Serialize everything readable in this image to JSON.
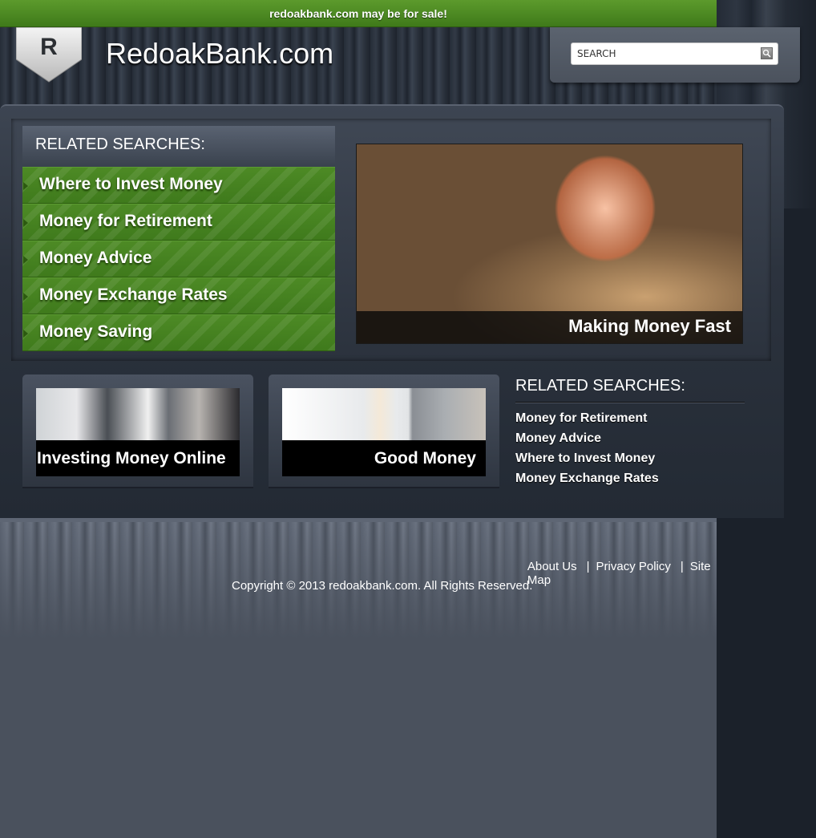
{
  "sale_banner": "redoakbank.com may be for sale!",
  "logo": {
    "letter": "R",
    "icon": "shield-badge-icon"
  },
  "site_title": "RedoakBank.com",
  "search": {
    "placeholder": "SEARCH",
    "icon": "search-icon"
  },
  "related_searches_main": {
    "heading": "RELATED SEARCHES:",
    "items": [
      {
        "label": "Where to Invest Money"
      },
      {
        "label": "Money for Retirement"
      },
      {
        "label": "Money Advice"
      },
      {
        "label": "Money Exchange Rates"
      },
      {
        "label": "Money Saving"
      }
    ]
  },
  "feature": {
    "caption": "Making Money Fast"
  },
  "cards": [
    {
      "title": "Investing Money Online"
    },
    {
      "title": "Good Money"
    }
  ],
  "related_searches_side": {
    "heading": "RELATED SEARCHES:",
    "items": [
      {
        "label": "Money for Retirement"
      },
      {
        "label": "Money Advice"
      },
      {
        "label": "Where to Invest Money"
      },
      {
        "label": "Money Exchange Rates"
      }
    ]
  },
  "footer": {
    "links": [
      {
        "label": "About Us"
      },
      {
        "label": "Privacy Policy"
      },
      {
        "label": "Site Map"
      }
    ],
    "separator": "|",
    "copyright": "Copyright © 2013 redoakbank.com. All Rights Reserved."
  },
  "colors": {
    "accent_green": "#4a8a24",
    "dark_bg": "#232a34",
    "footer_bg": "#4a515d"
  }
}
